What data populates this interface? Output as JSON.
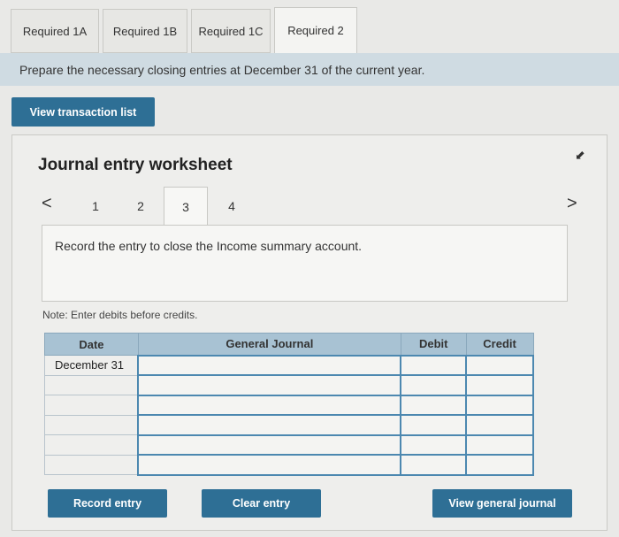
{
  "tabs": [
    {
      "label": "Required 1A",
      "active": false
    },
    {
      "label": "Required 1B",
      "active": false
    },
    {
      "label": "Required 1C",
      "active": false
    },
    {
      "label": "Required 2",
      "active": true
    }
  ],
  "instruction": "Prepare the necessary closing entries at December 31 of the current year.",
  "view_transaction_list": "View transaction list",
  "worksheet": {
    "title": "Journal entry worksheet",
    "prev_glyph": "<",
    "next_glyph": ">",
    "pages": [
      "1",
      "2",
      "3",
      "4"
    ],
    "active_page": "3",
    "record_text": "Record the entry to close the Income summary account.",
    "note": "Note: Enter debits before credits."
  },
  "journal": {
    "headers": [
      "Date",
      "General Journal",
      "Debit",
      "Credit"
    ],
    "rows": [
      {
        "date": "December 31",
        "account": "",
        "debit": "",
        "credit": ""
      },
      {
        "date": "",
        "account": "",
        "debit": "",
        "credit": ""
      },
      {
        "date": "",
        "account": "",
        "debit": "",
        "credit": ""
      },
      {
        "date": "",
        "account": "",
        "debit": "",
        "credit": ""
      },
      {
        "date": "",
        "account": "",
        "debit": "",
        "credit": ""
      },
      {
        "date": "",
        "account": "",
        "debit": "",
        "credit": ""
      }
    ]
  },
  "buttons": {
    "record_entry": "Record entry",
    "clear_entry": "Clear entry",
    "view_general_journal": "View general journal"
  },
  "colors": {
    "accent": "#2e6f95",
    "header_bg": "#a8c2d3",
    "instruction_bg": "#cfdbe2"
  }
}
